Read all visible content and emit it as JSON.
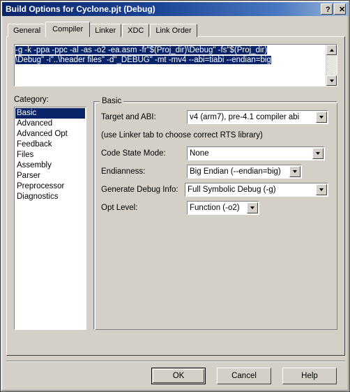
{
  "window": {
    "title": "Build Options for Cyclone.pjt (Debug)",
    "help_button": "?",
    "close_button": "✕"
  },
  "tabs": [
    {
      "label": "General",
      "selected": false
    },
    {
      "label": "Compiler",
      "selected": true
    },
    {
      "label": "Linker",
      "selected": false
    },
    {
      "label": "XDC",
      "selected": false
    },
    {
      "label": "Link Order",
      "selected": false
    }
  ],
  "command_line": {
    "line1": "-g -k -ppa -ppc -al -as -o2 -ea.asm -fr\"$(Proj_dir)\\Debug\" -fs\"$(Proj_dir)",
    "line2": "\\Debug\" -i\"..\\header files\" -d\"_DEBUG\" -mt -mv4 --abi=tiabi --endian=big",
    "selected": true,
    "scroll_up_icon": "triangle-up-icon",
    "scroll_down_icon": "triangle-down-icon"
  },
  "category": {
    "label": "Category:",
    "items": [
      {
        "label": "Basic",
        "selected": true
      },
      {
        "label": "Advanced",
        "selected": false
      },
      {
        "label": "Advanced Opt",
        "selected": false
      },
      {
        "label": "Feedback",
        "selected": false
      },
      {
        "label": "Files",
        "selected": false
      },
      {
        "label": "Assembly",
        "selected": false
      },
      {
        "label": "Parser",
        "selected": false
      },
      {
        "label": "Preprocessor",
        "selected": false
      },
      {
        "label": "Diagnostics",
        "selected": false
      }
    ]
  },
  "basic_group": {
    "title": "Basic",
    "target_abi_label": "Target and ABI:",
    "target_abi_value": "v4 (arm7), pre-4.1 compiler abi",
    "rts_note": "(use Linker tab to choose correct RTS library)",
    "code_state_label": "Code State Mode:",
    "code_state_value": "None",
    "endianness_label": "Endianness:",
    "endianness_value": "Big Endian (--endian=big)",
    "debug_info_label": "Generate Debug Info:",
    "debug_info_value": "Full Symbolic Debug (-g)",
    "opt_level_label": "Opt Level:",
    "opt_level_value": "Function (-o2)"
  },
  "buttons": {
    "ok": "OK",
    "cancel": "Cancel",
    "help": "Help"
  },
  "colors": {
    "dialog_face": "#d4d0c8",
    "titlebar_start": "#0a246a",
    "selection": "#0a246a",
    "selection_text": "#ffffff"
  }
}
